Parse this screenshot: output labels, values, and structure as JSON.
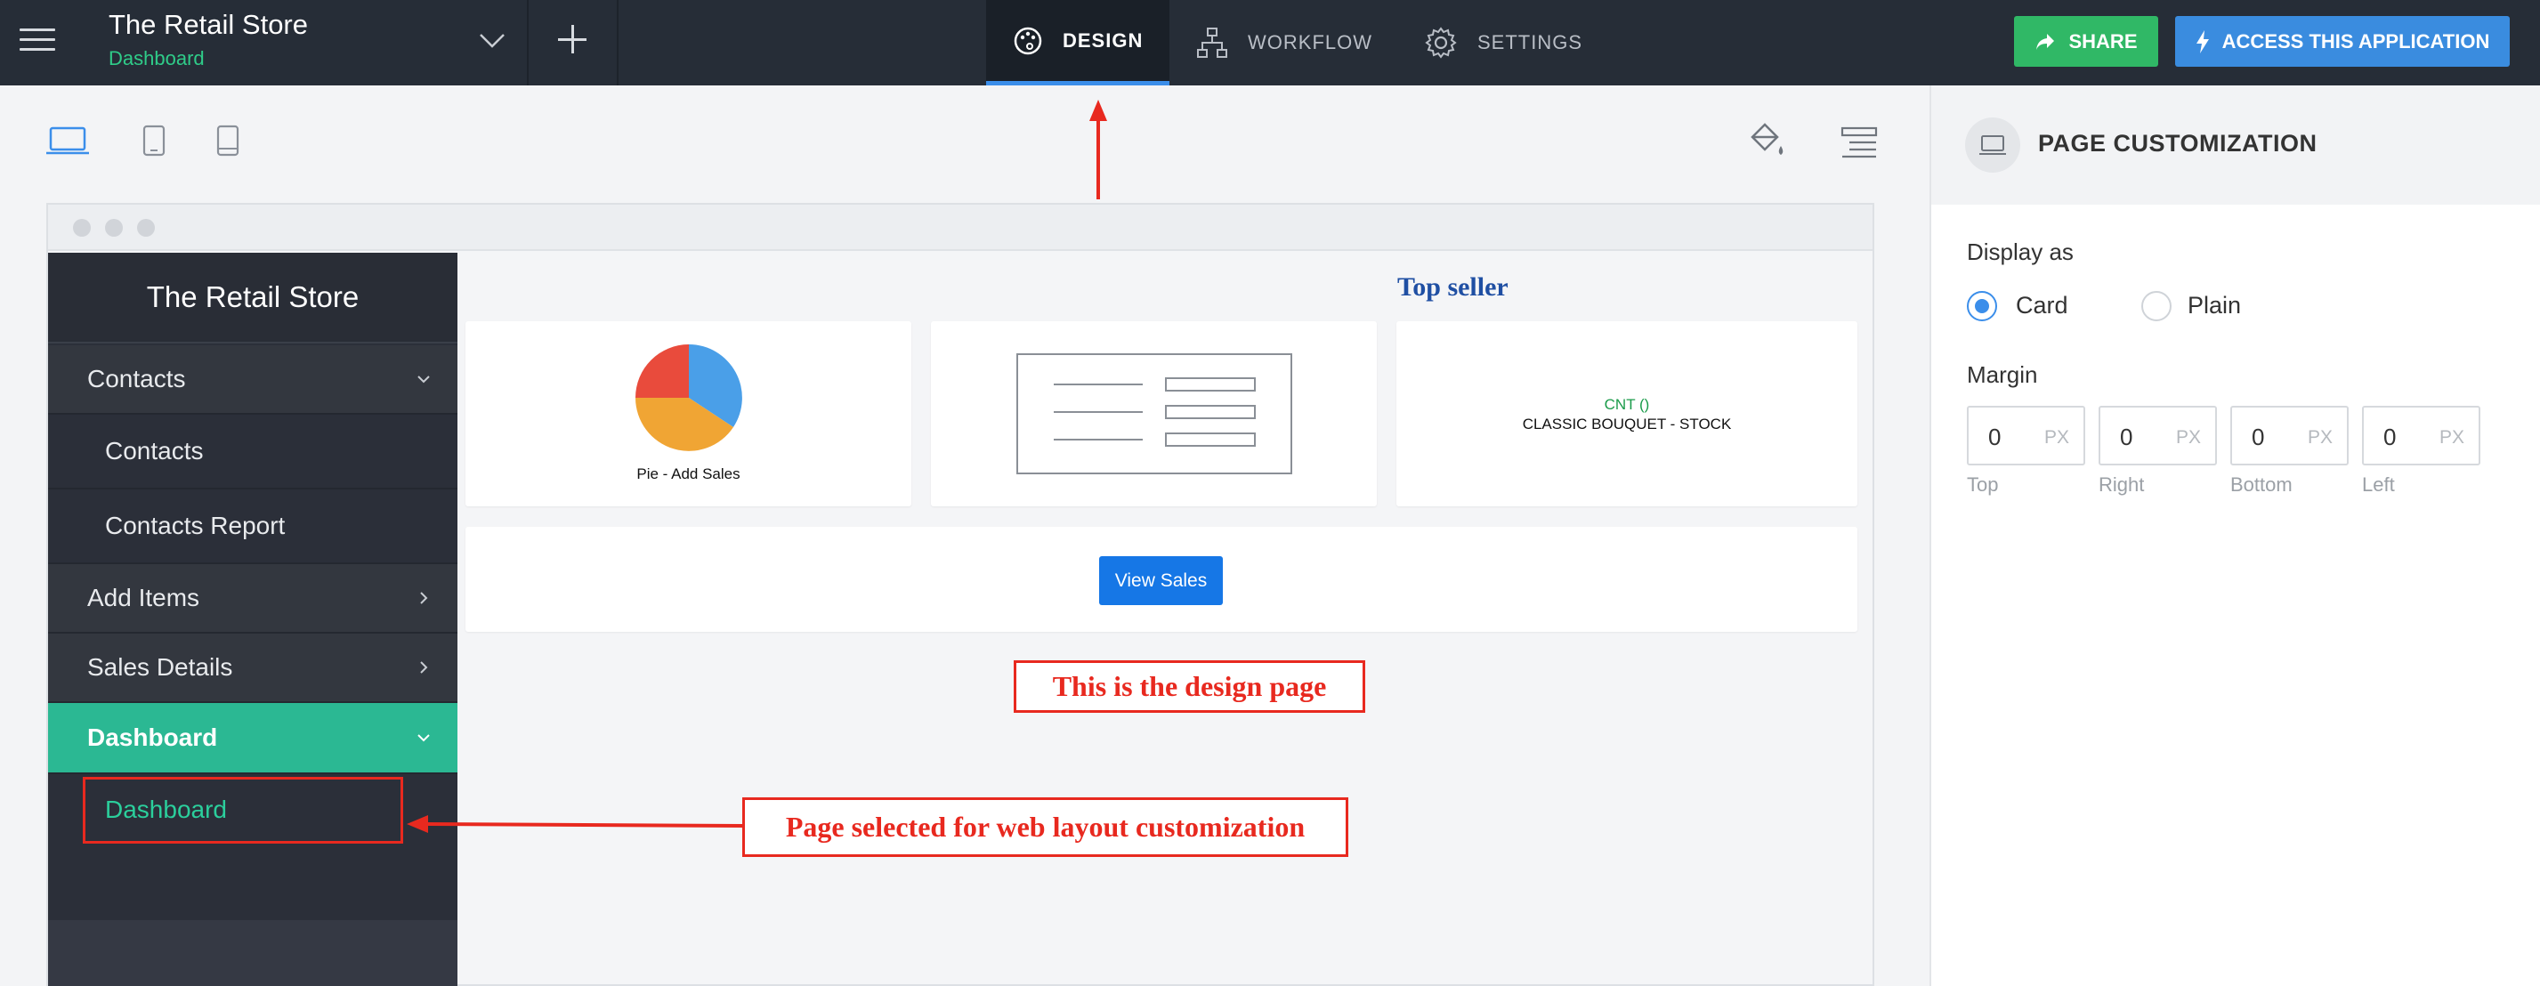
{
  "topbar": {
    "app_title": "The Retail Store",
    "app_subtitle": "Dashboard",
    "tabs": [
      {
        "label": "DESIGN",
        "active": true
      },
      {
        "label": "WORKFLOW",
        "active": false
      },
      {
        "label": "SETTINGS",
        "active": false
      }
    ],
    "share_label": "SHARE",
    "access_label": "ACCESS THIS APPLICATION"
  },
  "colors": {
    "topbar_bg": "#262d37",
    "accent_blue": "#3b8eea",
    "share_green": "#30b866",
    "menu_active_teal": "#2bb893",
    "annotation_red": "#e8291f"
  },
  "device_toolbar": {
    "icons": [
      "desktop-icon",
      "tablet-icon",
      "tablet-landscape-icon",
      "paint-bucket-icon",
      "menu-layout-icon"
    ]
  },
  "preview": {
    "menu_title": "The Retail Store",
    "menu": [
      {
        "label": "Contacts",
        "level": 1,
        "chevron": "down"
      },
      {
        "label": "Contacts",
        "level": 2
      },
      {
        "label": "Contacts Report",
        "level": 2
      },
      {
        "label": "Add Items",
        "level": 1,
        "chevron": "right"
      },
      {
        "label": "Sales Details",
        "level": 1,
        "chevron": "right"
      },
      {
        "label": "Dashboard",
        "level": 1,
        "chevron": "down",
        "active": true
      },
      {
        "label": "Dashboard",
        "level": 2,
        "selected": true
      }
    ],
    "top_seller_title": "Top seller",
    "pie_label": "Pie - Add Sales",
    "cnt_label": "CNT ()",
    "cnt_field": "CLASSIC BOUQUET - STOCK",
    "view_sales_label": "View Sales"
  },
  "annotations": {
    "design_page": "This is the design page",
    "page_selected": "Page selected for web layout customization"
  },
  "right_panel": {
    "title": "PAGE CUSTOMIZATION",
    "display_as_label": "Display as",
    "display_options": [
      {
        "label": "Card",
        "selected": true
      },
      {
        "label": "Plain",
        "selected": false
      }
    ],
    "margin_label": "Margin",
    "margins": [
      {
        "value": "0",
        "unit": "PX",
        "caption": "Top"
      },
      {
        "value": "0",
        "unit": "PX",
        "caption": "Right"
      },
      {
        "value": "0",
        "unit": "PX",
        "caption": "Bottom"
      },
      {
        "value": "0",
        "unit": "PX",
        "caption": "Left"
      }
    ]
  }
}
